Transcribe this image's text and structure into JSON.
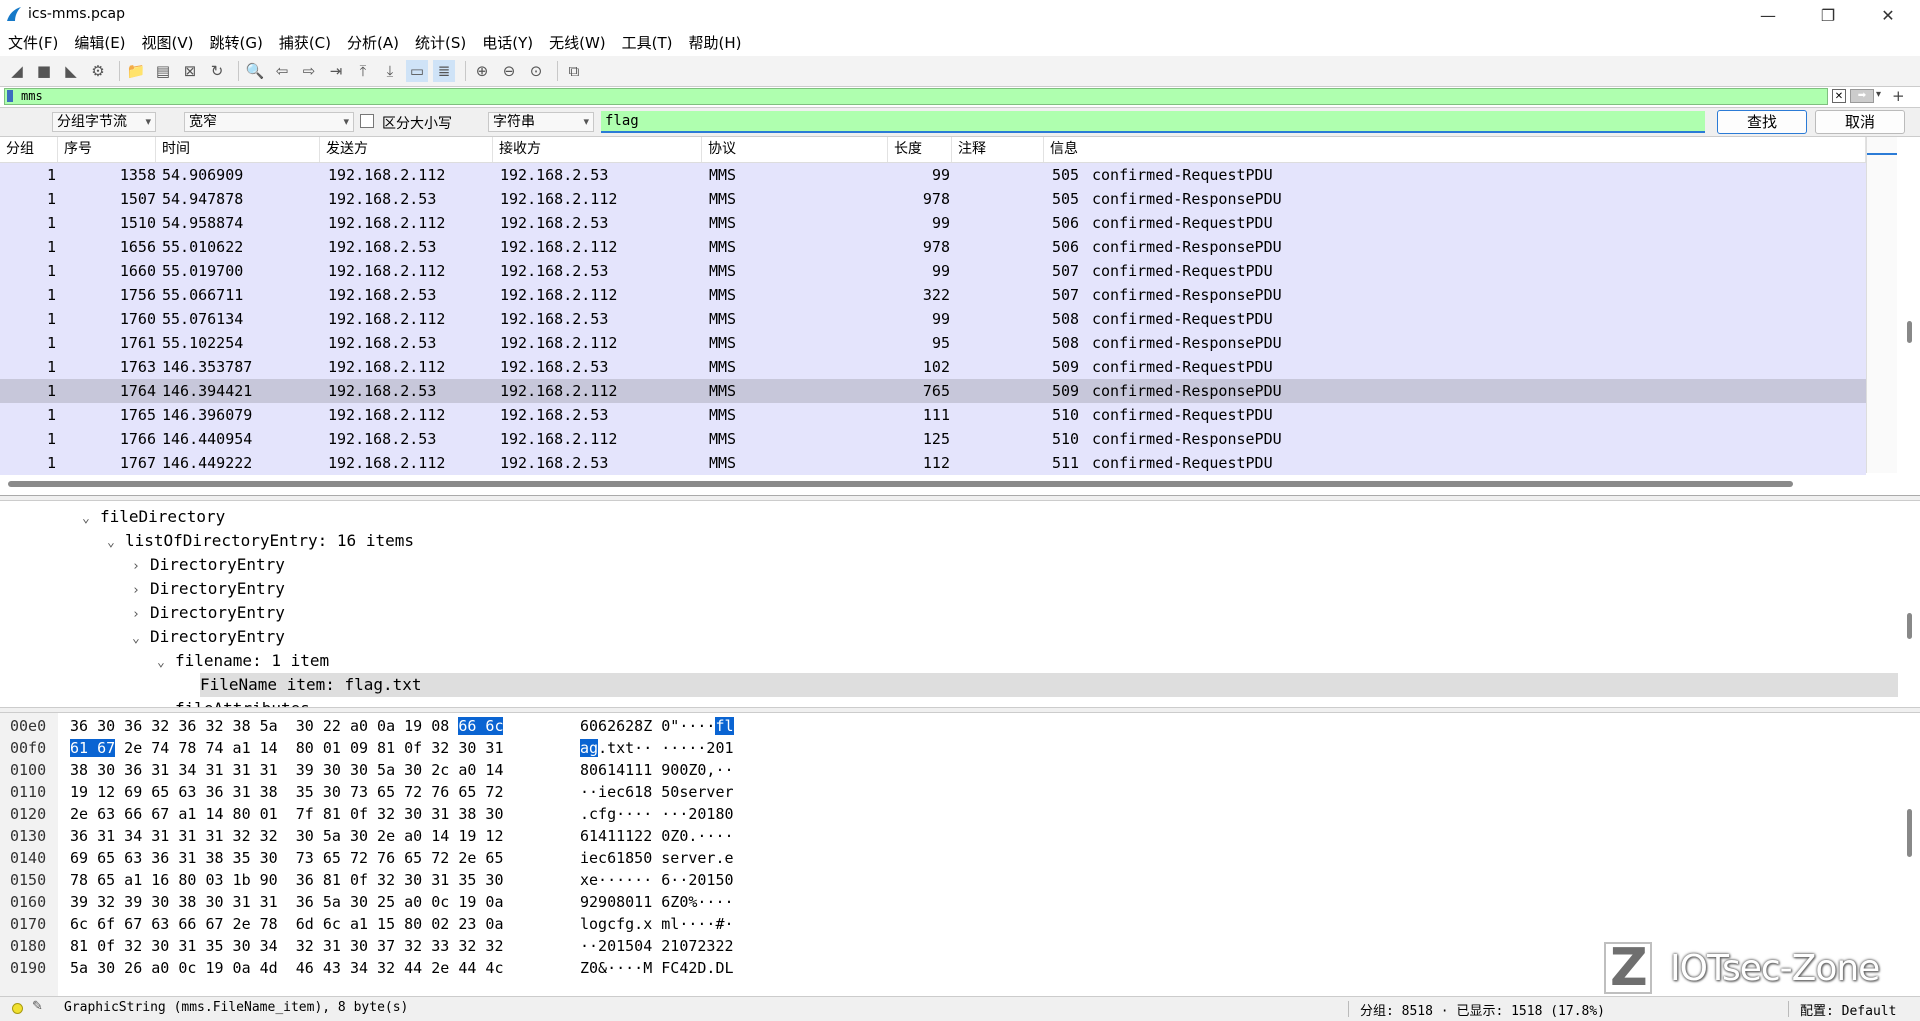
{
  "window": {
    "title": "ics-mms.pcap",
    "controls": {
      "minimize": "—",
      "restore": "❐",
      "close": "✕"
    }
  },
  "menu": [
    "文件(F)",
    "编辑(E)",
    "视图(V)",
    "跳转(G)",
    "捕获(C)",
    "分析(A)",
    "统计(S)",
    "电话(Y)",
    "无线(W)",
    "工具(T)",
    "帮助(H)"
  ],
  "toolbar_icons": [
    "shark-fin-start-icon",
    "stop-capture-icon",
    "restart-capture-icon",
    "capture-options-icon",
    "open-file-icon",
    "save-file-icon",
    "close-file-icon",
    "reload-file-icon",
    "find-packet-icon",
    "go-back-icon",
    "go-forward-icon",
    "go-to-packet-icon",
    "go-first-icon",
    "go-last-icon",
    "auto-scroll-icon",
    "colorize-icon",
    "zoom-in-icon",
    "zoom-out-icon",
    "zoom-reset-icon",
    "resize-columns-icon"
  ],
  "display_filter": {
    "value": "mms"
  },
  "find_bar": {
    "search_in": "分组字节流",
    "char_width": "宽窄",
    "case_sensitive_label": "区分大小写",
    "search_type": "字符串",
    "search_text": "flag",
    "find_label": "查找",
    "cancel_label": "取消"
  },
  "packet_list": {
    "columns": [
      "分组",
      "序号",
      "时间",
      "发送方",
      "接收方",
      "协议",
      "长度",
      "注释",
      "信息"
    ],
    "rows": [
      {
        "group": "1",
        "no": "1358",
        "time": "54.906909",
        "src": "192.168.2.112",
        "dst": "192.168.2.53",
        "proto": "MMS",
        "len": "99",
        "info_id": "505",
        "info": "confirmed-RequestPDU"
      },
      {
        "group": "1",
        "no": "1507",
        "time": "54.947878",
        "src": "192.168.2.53",
        "dst": "192.168.2.112",
        "proto": "MMS",
        "len": "978",
        "info_id": "505",
        "info": "confirmed-ResponsePDU"
      },
      {
        "group": "1",
        "no": "1510",
        "time": "54.958874",
        "src": "192.168.2.112",
        "dst": "192.168.2.53",
        "proto": "MMS",
        "len": "99",
        "info_id": "506",
        "info": "confirmed-RequestPDU"
      },
      {
        "group": "1",
        "no": "1656",
        "time": "55.010622",
        "src": "192.168.2.53",
        "dst": "192.168.2.112",
        "proto": "MMS",
        "len": "978",
        "info_id": "506",
        "info": "confirmed-ResponsePDU"
      },
      {
        "group": "1",
        "no": "1660",
        "time": "55.019700",
        "src": "192.168.2.112",
        "dst": "192.168.2.53",
        "proto": "MMS",
        "len": "99",
        "info_id": "507",
        "info": "confirmed-RequestPDU"
      },
      {
        "group": "1",
        "no": "1756",
        "time": "55.066711",
        "src": "192.168.2.53",
        "dst": "192.168.2.112",
        "proto": "MMS",
        "len": "322",
        "info_id": "507",
        "info": "confirmed-ResponsePDU"
      },
      {
        "group": "1",
        "no": "1760",
        "time": "55.076134",
        "src": "192.168.2.112",
        "dst": "192.168.2.53",
        "proto": "MMS",
        "len": "99",
        "info_id": "508",
        "info": "confirmed-RequestPDU"
      },
      {
        "group": "1",
        "no": "1761",
        "time": "55.102254",
        "src": "192.168.2.53",
        "dst": "192.168.2.112",
        "proto": "MMS",
        "len": "95",
        "info_id": "508",
        "info": "confirmed-ResponsePDU"
      },
      {
        "group": "1",
        "no": "1763",
        "time": "146.353787",
        "src": "192.168.2.112",
        "dst": "192.168.2.53",
        "proto": "MMS",
        "len": "102",
        "info_id": "509",
        "info": "confirmed-RequestPDU"
      },
      {
        "group": "1",
        "no": "1764",
        "time": "146.394421",
        "src": "192.168.2.53",
        "dst": "192.168.2.112",
        "proto": "MMS",
        "len": "765",
        "info_id": "509",
        "info": "confirmed-ResponsePDU",
        "selected": true
      },
      {
        "group": "1",
        "no": "1765",
        "time": "146.396079",
        "src": "192.168.2.112",
        "dst": "192.168.2.53",
        "proto": "MMS",
        "len": "111",
        "info_id": "510",
        "info": "confirmed-RequestPDU"
      },
      {
        "group": "1",
        "no": "1766",
        "time": "146.440954",
        "src": "192.168.2.53",
        "dst": "192.168.2.112",
        "proto": "MMS",
        "len": "125",
        "info_id": "510",
        "info": "confirmed-ResponsePDU"
      },
      {
        "group": "1",
        "no": "1767",
        "time": "146.449222",
        "src": "192.168.2.112",
        "dst": "192.168.2.53",
        "proto": "MMS",
        "len": "112",
        "info_id": "511",
        "info": "confirmed-RequestPDU"
      }
    ]
  },
  "detail_tree": [
    {
      "depth": 0,
      "expanded": true,
      "label": "fileDirectory"
    },
    {
      "depth": 1,
      "expanded": true,
      "label": "listOfDirectoryEntry: 16 items"
    },
    {
      "depth": 2,
      "expanded": false,
      "label": "DirectoryEntry"
    },
    {
      "depth": 2,
      "expanded": false,
      "label": "DirectoryEntry"
    },
    {
      "depth": 2,
      "expanded": false,
      "label": "DirectoryEntry"
    },
    {
      "depth": 2,
      "expanded": true,
      "label": "DirectoryEntry"
    },
    {
      "depth": 3,
      "expanded": true,
      "label": "filename: 1 item"
    },
    {
      "depth": 4,
      "leaf": true,
      "selected": true,
      "label": "FileName item: flag.txt"
    },
    {
      "depth": 3,
      "expanded": false,
      "label": "fileAttributes"
    }
  ],
  "hex_dump": [
    {
      "offset": "00e0",
      "bytes": [
        [
          "36 30 36 32 36 32 38 5a  30 22 a0 0a 19 08 ",
          false
        ],
        [
          "66 6c",
          true
        ]
      ],
      "ascii": [
        [
          "6062628Z 0\"····",
          false
        ],
        [
          "fl",
          true
        ]
      ]
    },
    {
      "offset": "00f0",
      "bytes": [
        [
          "61 67",
          true
        ],
        [
          " 2e 74 78 74 a1 14  80 01 09 81 0f 32 30 31",
          false
        ]
      ],
      "ascii": [
        [
          "ag",
          true
        ],
        [
          ".txt·· ·····201",
          false
        ]
      ]
    },
    {
      "offset": "0100",
      "bytes": [
        [
          "38 30 36 31 34 31 31 31  39 30 30 5a 30 2c a0 14",
          false
        ]
      ],
      "ascii": [
        [
          "80614111 900Z0,··",
          false
        ]
      ]
    },
    {
      "offset": "0110",
      "bytes": [
        [
          "19 12 69 65 63 36 31 38  35 30 73 65 72 76 65 72",
          false
        ]
      ],
      "ascii": [
        [
          "··iec618 50server",
          false
        ]
      ]
    },
    {
      "offset": "0120",
      "bytes": [
        [
          "2e 63 66 67 a1 14 80 01  7f 81 0f 32 30 31 38 30",
          false
        ]
      ],
      "ascii": [
        [
          ".cfg···· ···20180",
          false
        ]
      ]
    },
    {
      "offset": "0130",
      "bytes": [
        [
          "36 31 34 31 31 31 32 32  30 5a 30 2e a0 14 19 12",
          false
        ]
      ],
      "ascii": [
        [
          "61411122 0Z0.····",
          false
        ]
      ]
    },
    {
      "offset": "0140",
      "bytes": [
        [
          "69 65 63 36 31 38 35 30  73 65 72 76 65 72 2e 65",
          false
        ]
      ],
      "ascii": [
        [
          "iec61850 server.e",
          false
        ]
      ]
    },
    {
      "offset": "0150",
      "bytes": [
        [
          "78 65 a1 16 80 03 1b 90  36 81 0f 32 30 31 35 30",
          false
        ]
      ],
      "ascii": [
        [
          "xe······ 6··20150",
          false
        ]
      ]
    },
    {
      "offset": "0160",
      "bytes": [
        [
          "39 32 39 30 38 30 31 31  36 5a 30 25 a0 0c 19 0a",
          false
        ]
      ],
      "ascii": [
        [
          "92908011 6Z0%····",
          false
        ]
      ]
    },
    {
      "offset": "0170",
      "bytes": [
        [
          "6c 6f 67 63 66 67 2e 78  6d 6c a1 15 80 02 23 0a",
          false
        ]
      ],
      "ascii": [
        [
          "logcfg.x ml····#·",
          false
        ]
      ]
    },
    {
      "offset": "0180",
      "bytes": [
        [
          "81 0f 32 30 31 35 30 34  32 31 30 37 32 33 32 32",
          false
        ]
      ],
      "ascii": [
        [
          "··201504 21072322",
          false
        ]
      ]
    },
    {
      "offset": "0190",
      "bytes": [
        [
          "5a 30 26 a0 0c 19 0a 4d  46 43 34 32 44 2e 44 4c",
          false
        ]
      ],
      "ascii": [
        [
          "Z0&····M FC42D.DL",
          false
        ]
      ]
    }
  ],
  "watermark": {
    "logo_letter": "Z",
    "text": "IOTsec-Zone"
  },
  "status": {
    "field_info": "GraphicString (mms.FileName_item), 8 byte(s)",
    "packets": "分组: 8518 · 已显示: 1518 (17.8%)",
    "profile": "配置: Default"
  },
  "colors": {
    "filter_ok": "#afffaf",
    "row_bg": "#e4e4fc",
    "row_selected": "#c7c7da",
    "hex_highlight": "#0a64d2"
  }
}
